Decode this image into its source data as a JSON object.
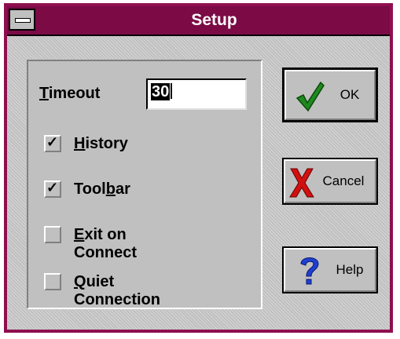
{
  "window": {
    "title": "Setup"
  },
  "form": {
    "timeout_label_first": "T",
    "timeout_label_rest": "imeout",
    "timeout_value": "30",
    "options": [
      {
        "mnemonic": "H",
        "rest": "istory",
        "checked": true
      },
      {
        "before": "Tool",
        "mnemonic": "b",
        "rest": "ar",
        "checked": true
      },
      {
        "mnemonic": "E",
        "rest": "xit on Connect",
        "checked": false
      },
      {
        "mnemonic": "Q",
        "rest": "uiet Connection",
        "checked": false
      }
    ],
    "check_glyph": "✓"
  },
  "buttons": {
    "ok": {
      "label": "OK",
      "icon": "checkmark-icon"
    },
    "cancel": {
      "label": "Cancel",
      "icon": "x-icon"
    },
    "help": {
      "label": "Help",
      "icon": "question-icon"
    }
  },
  "colors": {
    "titlebar": "#7b0a45",
    "frame": "#8e0f4f",
    "face": "#c0c0c0",
    "ok_check": "#1f8a1f",
    "cancel_x": "#d21010",
    "help_q": "#1f3fd0"
  }
}
